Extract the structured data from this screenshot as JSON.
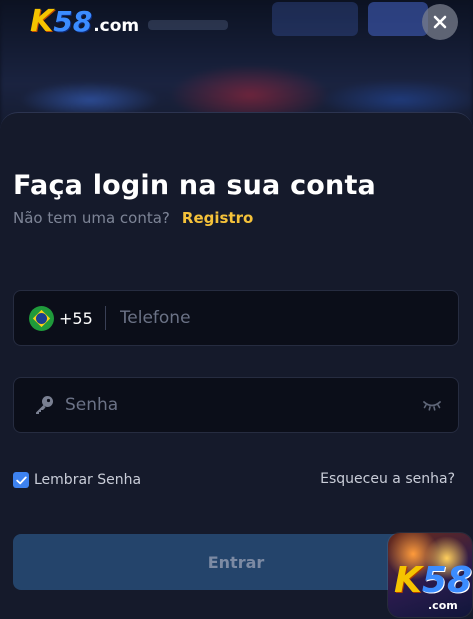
{
  "header": {
    "logo": {
      "k": "K",
      "number": "58",
      "domain": ".com"
    },
    "close_icon": "close-icon"
  },
  "login": {
    "title": "Faça login na sua conta",
    "subtitle": "Não tem uma conta?",
    "register_link": "Registro",
    "phone": {
      "country_flag": "brazil-flag-icon",
      "country_code": "+55",
      "placeholder": "Telefone",
      "value": ""
    },
    "password": {
      "icon": "key-icon",
      "placeholder": "Senha",
      "value": "",
      "toggle_icon": "eye-closed-icon"
    },
    "remember": {
      "label": "Lembrar Senha",
      "checked": true
    },
    "forgot_link": "Esqueceu a senha?",
    "submit_label": "Entrar"
  },
  "app_icon": {
    "k": "K",
    "number": "58",
    "domain": ".com"
  },
  "colors": {
    "background": "#151a2b",
    "accent_yellow": "#f5c23a",
    "checkbox_blue": "#3d82f0",
    "button_bg": "#24446b"
  }
}
